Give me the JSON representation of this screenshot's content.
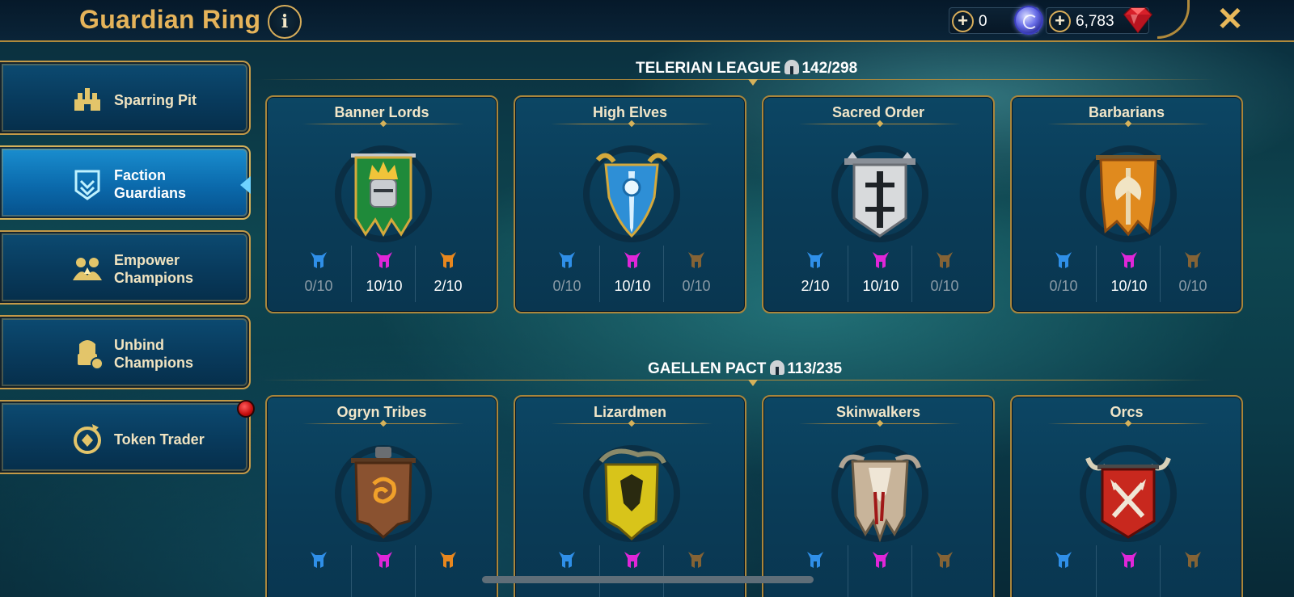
{
  "header": {
    "title": "Guardian Ring",
    "info_label": "i",
    "currency_a_value": "0",
    "currency_b_value": "6,783",
    "close_label": "✕"
  },
  "sidebar": {
    "items": [
      {
        "label_line1": "Sparring Pit",
        "label_line2": ""
      },
      {
        "label_line1": "Faction",
        "label_line2": "Guardians"
      },
      {
        "label_line1": "Empower",
        "label_line2": "Champions"
      },
      {
        "label_line1": "Unbind",
        "label_line2": "Champions"
      },
      {
        "label_line1": "Token Trader",
        "label_line2": ""
      }
    ]
  },
  "sections": [
    {
      "name": "TELERIAN LEAGUE",
      "count": "142/298",
      "cards": [
        {
          "name": "Banner Lords",
          "stats": [
            "0/10",
            "10/10",
            "2/10"
          ]
        },
        {
          "name": "High Elves",
          "stats": [
            "0/10",
            "10/10",
            "0/10"
          ]
        },
        {
          "name": "Sacred Order",
          "stats": [
            "2/10",
            "10/10",
            "0/10"
          ]
        },
        {
          "name": "Barbarians",
          "stats": [
            "0/10",
            "10/10",
            "0/10"
          ]
        }
      ]
    },
    {
      "name": "GAELLEN PACT",
      "count": "113/235",
      "cards": [
        {
          "name": "Ogryn Tribes",
          "stats": [
            "",
            "",
            ""
          ]
        },
        {
          "name": "Lizardmen",
          "stats": [
            "",
            "",
            ""
          ]
        },
        {
          "name": "Skinwalkers",
          "stats": [
            "",
            "",
            ""
          ]
        },
        {
          "name": "Orcs",
          "stats": [
            "",
            "",
            ""
          ]
        }
      ]
    }
  ],
  "colors": {
    "gold": "#e5b35a",
    "rare_blue": "#2f8fe8",
    "epic_magenta": "#e026d8",
    "legendary_orange": "#e8871e"
  },
  "icons": {
    "rarity": [
      "rare-helmet-icon",
      "epic-helmet-icon",
      "legendary-helmet-icon"
    ]
  }
}
